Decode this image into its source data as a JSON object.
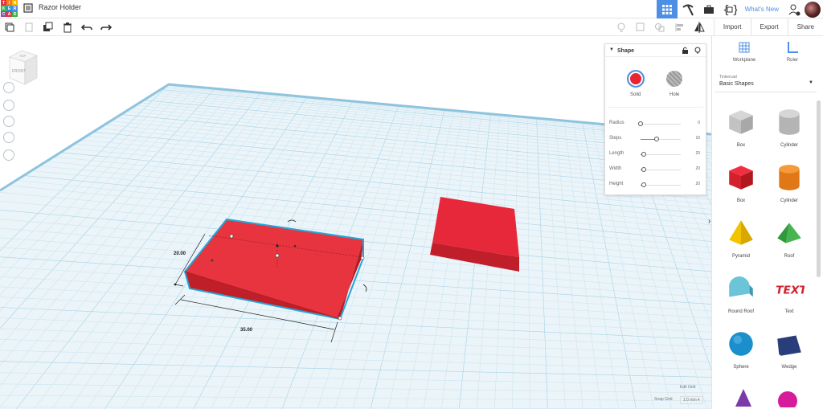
{
  "app": {
    "logo_letters": [
      "T",
      "I",
      "N",
      "K",
      "E",
      "R",
      "C",
      "A",
      "D"
    ],
    "logo_colors": [
      "#e7353a",
      "#f47c22",
      "#f7b600",
      "#3cb44a",
      "#1d9bd9",
      "#4d8fe5",
      "#8d4fa0",
      "#e7353a",
      "#3cb44a"
    ],
    "title": "Razor Holder"
  },
  "topbar": {
    "whats_new": "What's New",
    "icons": [
      "grid-view-icon",
      "pickaxe-icon",
      "briefcase-icon",
      "code-blocks-icon"
    ]
  },
  "toolbar": {
    "tabs": [
      "Import",
      "Export",
      "Share"
    ]
  },
  "navcube": {
    "top": "TOP",
    "front": "FRONT"
  },
  "shape_panel": {
    "title": "Shape",
    "solid_label": "Solid",
    "hole_label": "Hole",
    "solid_color": "#e7242f",
    "properties": [
      {
        "name": "Radius",
        "value": "0",
        "level": 0.0
      },
      {
        "name": "Steps",
        "value": "10",
        "level": 0.4
      },
      {
        "name": "Length",
        "value": "20",
        "level": 0.08
      },
      {
        "name": "Width",
        "value": "20",
        "level": 0.08
      },
      {
        "name": "Height",
        "value": "20",
        "level": 0.08
      }
    ]
  },
  "sidebar": {
    "workplane_label": "Workplane",
    "ruler_label": "Ruler",
    "library_sub": "Tinkercad",
    "library_name": "Basic Shapes",
    "shapes": [
      {
        "label": "Box",
        "icon": "box-hole-icon"
      },
      {
        "label": "Cylinder",
        "icon": "cylinder-hole-icon"
      },
      {
        "label": "Box",
        "icon": "box-icon"
      },
      {
        "label": "Cylinder",
        "icon": "cylinder-icon"
      },
      {
        "label": "Pyramid",
        "icon": "pyramid-icon"
      },
      {
        "label": "Roof",
        "icon": "roof-icon"
      },
      {
        "label": "Round Roof",
        "icon": "round-roof-icon"
      },
      {
        "label": "Text",
        "icon": "text-3d-icon"
      },
      {
        "label": "Sphere",
        "icon": "sphere-icon"
      },
      {
        "label": "Wedge",
        "icon": "wedge-icon"
      }
    ]
  },
  "viewport": {
    "dimension_width": "20.00",
    "dimension_length": "35.00",
    "edit_grid": "Edit Grid",
    "snap_grid_label": "Snap Grid",
    "snap_grid_value": "1.0 mm"
  }
}
